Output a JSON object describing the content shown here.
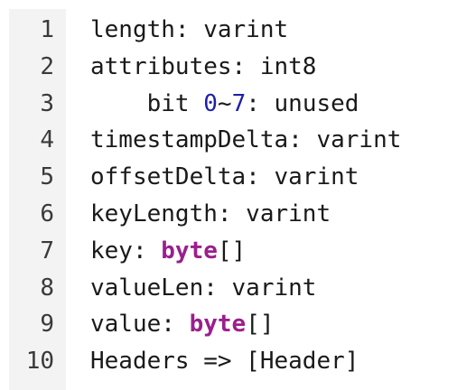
{
  "code_block": {
    "line_numbers": [
      "1",
      "2",
      "3",
      "4",
      "5",
      "6",
      "7",
      "8",
      "9",
      "10"
    ],
    "lines": {
      "l1": "length: varint",
      "l2": "attributes: int8",
      "l3": {
        "indent": "    ",
        "prefix": "bit ",
        "num_start": "0",
        "tilde": "~",
        "num_end": "7",
        "suffix": ": unused"
      },
      "l4": "timestampDelta: varint",
      "l5": "offsetDelta: varint",
      "l6": "keyLength: varint",
      "l7": {
        "prefix": "key: ",
        "keyword": "byte",
        "suffix": "[]"
      },
      "l8": "valueLen: varint",
      "l9": {
        "prefix": "value: ",
        "keyword": "byte",
        "suffix": "[]"
      },
      "l10": "Headers => [Header]"
    },
    "colors": {
      "gutter_background": "#f3f3f3",
      "line_number": "#3a3a3a",
      "text": "#1a1a1a",
      "keyword": "#9b1f8c",
      "number": "#1f1fa8"
    }
  }
}
